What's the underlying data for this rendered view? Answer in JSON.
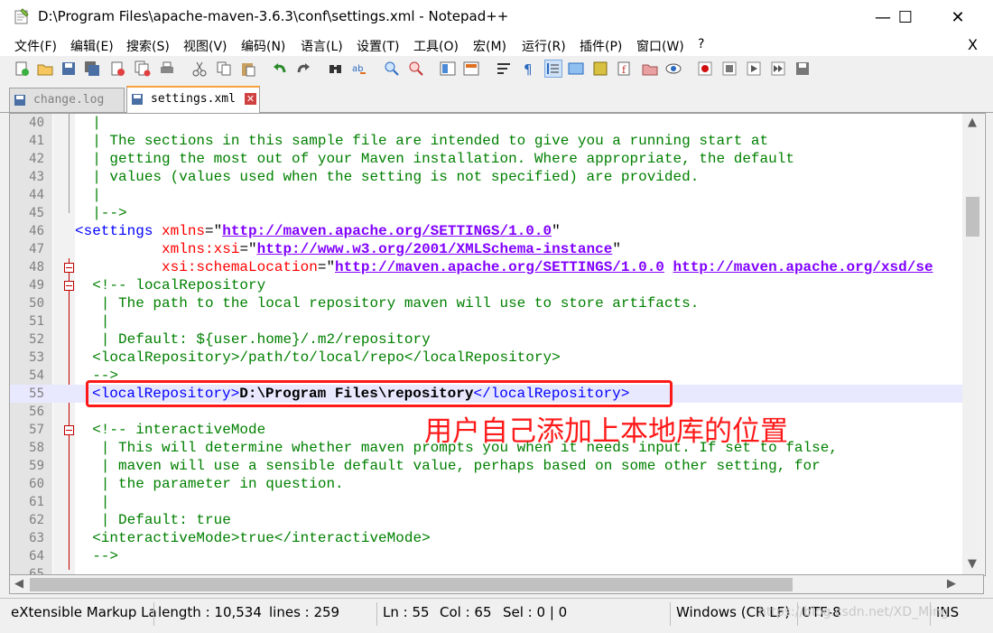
{
  "window": {
    "title": "D:\\Program Files\\apache-maven-3.6.3\\conf\\settings.xml - Notepad++",
    "minimize": "—",
    "maximize": "☐",
    "close": "✕"
  },
  "menu": {
    "items": [
      "文件(F)",
      "编辑(E)",
      "搜索(S)",
      "视图(V)",
      "编码(N)",
      "语言(L)",
      "设置(T)",
      "工具(O)",
      "宏(M)",
      "运行(R)",
      "插件(P)",
      "窗口(W)",
      "?"
    ],
    "close_doc": "X"
  },
  "tabs": [
    {
      "label": "change.log",
      "active": false
    },
    {
      "label": "settings.xml",
      "active": true
    }
  ],
  "editor": {
    "lines": [
      {
        "n": "40",
        "text": "  |"
      },
      {
        "n": "41",
        "text": "  | The sections in this sample file are intended to give you a running start at"
      },
      {
        "n": "42",
        "text": "  | getting the most out of your Maven installation. Where appropriate, the default"
      },
      {
        "n": "43",
        "text": "  | values (values used when the setting is not specified) are provided."
      },
      {
        "n": "44",
        "text": "  |"
      },
      {
        "n": "45",
        "text": "  |-->"
      },
      {
        "n": "46",
        "tag_open": "<settings ",
        "attr": "xmlns",
        "eq": "=\"",
        "val": "http://maven.apache.org/SETTINGS/1.0.0",
        "close": "\""
      },
      {
        "n": "47",
        "pad": "          ",
        "attr": "xmlns:xsi",
        "eq": "=\"",
        "val": "http://www.w3.org/2001/XMLSchema-instance",
        "close": "\""
      },
      {
        "n": "48",
        "pad": "          ",
        "attr": "xsi:schemaLocation",
        "eq": "=\"",
        "val": "http://maven.apache.org/SETTINGS/1.0.0",
        "gap": " ",
        "val2": "http://maven.apache.org/xsd/se"
      },
      {
        "n": "49",
        "text": "  <!-- localRepository"
      },
      {
        "n": "50",
        "text": "   | The path to the local repository maven will use to store artifacts."
      },
      {
        "n": "51",
        "text": "   |"
      },
      {
        "n": "52",
        "text": "   | Default: ${user.home}/.m2/repository"
      },
      {
        "n": "53",
        "text": "  <localRepository>/path/to/local/repo</localRepository>"
      },
      {
        "n": "54",
        "text": "  -->"
      },
      {
        "n": "55",
        "open": "<localRepository>",
        "value": "D:\\Program Files\\repository",
        "close": "</localRepository>"
      },
      {
        "n": "56",
        "text": ""
      },
      {
        "n": "57",
        "text": "  <!-- interactiveMode"
      },
      {
        "n": "58",
        "text": "   | This will determine whether maven prompts you when it needs input. If set to false,"
      },
      {
        "n": "59",
        "text": "   | maven will use a sensible default value, perhaps based on some other setting, for"
      },
      {
        "n": "60",
        "text": "   | the parameter in question."
      },
      {
        "n": "61",
        "text": "   |"
      },
      {
        "n": "62",
        "text": "   | Default: true"
      },
      {
        "n": "63",
        "text": "  <interactiveMode>true</interactiveMode>"
      },
      {
        "n": "64",
        "text": "  -->"
      },
      {
        "n": "65",
        "text": ""
      }
    ]
  },
  "annotation": "用户自己添加上本地库的位置",
  "status": {
    "type": "eXtensible Markup La",
    "length": "length : 10,534",
    "lines": "lines : 259",
    "ln": "Ln : 55",
    "col": "Col : 65",
    "sel": "Sel : 0 | 0",
    "eol": "Windows (CR LF)",
    "encoding": "UTF-8",
    "mode": "INS"
  },
  "watermark": "https://blog.csdn.net/XD_Ming",
  "colors": {
    "comment": "#008000",
    "tag": "#0000ff",
    "attr": "#ff0000",
    "value": "#8000ff",
    "annotation": "#ff1a1a"
  }
}
